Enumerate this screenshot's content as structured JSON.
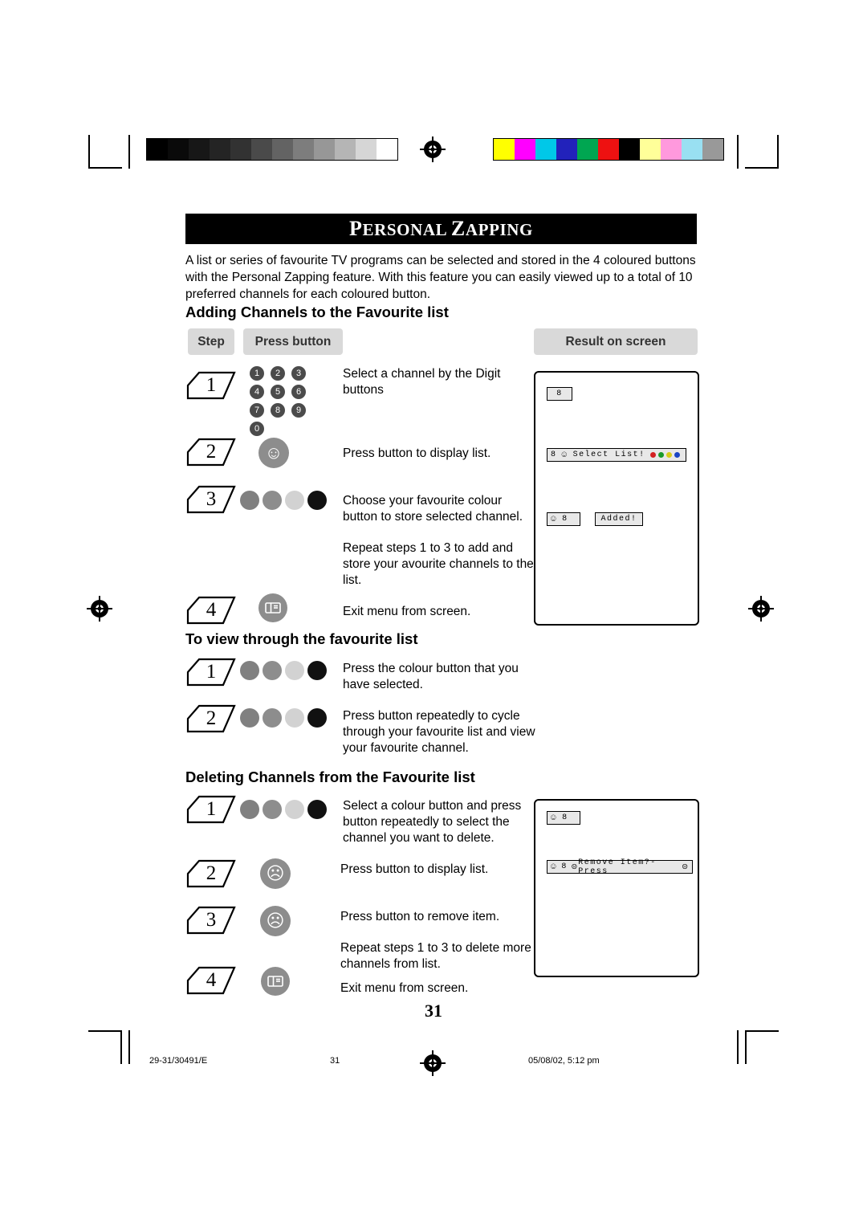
{
  "document": {
    "title": "Personal Zapping",
    "page_number": "31",
    "intro": "A list or series of favourite TV programs can be selected and stored in the 4 coloured buttons with the Personal Zapping feature. With this feature you can easily viewed up to a total of 10 preferred channels for each coloured button."
  },
  "table_headers": {
    "step": "Step",
    "press_button": "Press button",
    "result": "Result on screen"
  },
  "sections": [
    {
      "heading": "Adding Channels to the Favourite list",
      "steps": [
        {
          "num": "1",
          "text": "Select a channel by the Digit buttons"
        },
        {
          "num": "2",
          "text": "Press button to display list."
        },
        {
          "num": "3",
          "text": "Choose your favourite colour button to store selected channel."
        },
        {
          "num": "",
          "text": "Repeat steps 1 to 3 to add and store your avourite channels to the list."
        },
        {
          "num": "4",
          "text": "Exit menu from screen."
        }
      ]
    },
    {
      "heading": "To view through the favourite list",
      "steps": [
        {
          "num": "1",
          "text": "Press the colour button that you have selected."
        },
        {
          "num": "2",
          "text": "Press button repeatedly to cycle through your favourite list and view your favourite channel."
        }
      ]
    },
    {
      "heading": "Deleting Channels from the Favourite list",
      "steps": [
        {
          "num": "1",
          "text": "Select a colour button and press button repeatedly to select the channel you want to delete."
        },
        {
          "num": "2",
          "text": "Press button to display list."
        },
        {
          "num": "3",
          "text": "Press button to remove item."
        },
        {
          "num": "",
          "text": "Repeat steps 1 to 3 to delete more channels from list."
        },
        {
          "num": "4",
          "text": "Exit menu from screen."
        }
      ]
    }
  ],
  "keypad": {
    "keys": [
      "1",
      "2",
      "3",
      "4",
      "5",
      "6",
      "7",
      "8",
      "9",
      "0"
    ]
  },
  "osd": {
    "channel": "8",
    "select_list": "Select List!",
    "added": "Added!",
    "remove_item": "Remove Item?- Press"
  },
  "colors": {
    "dot_red": "#808080",
    "dot_green": "#8d8d8d",
    "dot_yellow": "#d2d2d2",
    "dot_blue": "#111111",
    "osd_dot_red": "#d32222",
    "osd_dot_green": "#1a9a2a",
    "osd_dot_yellow": "#d7cc1a",
    "osd_dot_blue": "#1a45c4"
  },
  "footer": {
    "left": "29-31/30491/E",
    "center": "31",
    "right": "05/08/02, 5:12 pm"
  },
  "colorbar": {
    "greys": [
      "#000000",
      "#0d0d0d",
      "#1a1a1a",
      "#262626",
      "#333333",
      "#4d4d4d",
      "#666666",
      "#808080",
      "#999999",
      "#b3b3b3",
      "#cccccc",
      "#ffffff"
    ],
    "colors": [
      "#ffff00",
      "#ff00ff",
      "#00ffff",
      "#2222cc",
      "#00a651",
      "#ee1111",
      "#000000",
      "#ffff88",
      "#ff88dd",
      "#88ddee",
      "#999999"
    ]
  }
}
